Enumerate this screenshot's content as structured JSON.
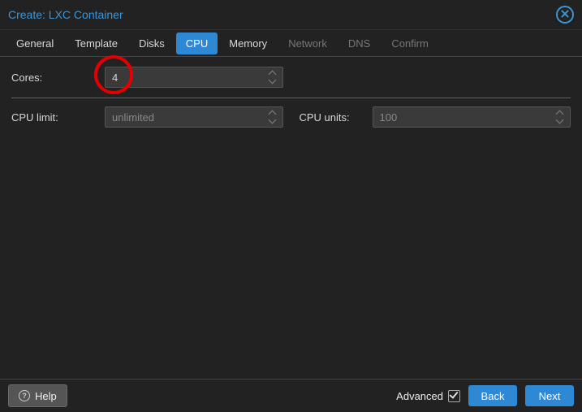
{
  "header": {
    "title": "Create: LXC Container"
  },
  "tabs": [
    {
      "label": "General",
      "state": "enabled"
    },
    {
      "label": "Template",
      "state": "enabled"
    },
    {
      "label": "Disks",
      "state": "enabled"
    },
    {
      "label": "CPU",
      "state": "active"
    },
    {
      "label": "Memory",
      "state": "enabled"
    },
    {
      "label": "Network",
      "state": "disabled"
    },
    {
      "label": "DNS",
      "state": "disabled"
    },
    {
      "label": "Confirm",
      "state": "disabled"
    }
  ],
  "cpu": {
    "cores_label": "Cores:",
    "cores_value": "4",
    "cpulimit_label": "CPU limit:",
    "cpulimit_placeholder": "unlimited",
    "cpuunits_label": "CPU units:",
    "cpuunits_placeholder": "100"
  },
  "footer": {
    "help": "Help",
    "advanced": "Advanced",
    "advanced_checked": true,
    "back": "Back",
    "next": "Next"
  }
}
